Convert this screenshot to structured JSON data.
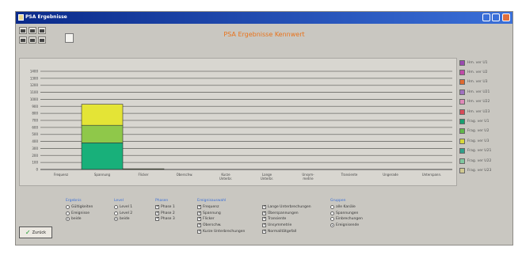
{
  "window": {
    "title": "PSA Ergebnisse"
  },
  "header": {
    "title": "PSA Ergebnisse Kennwert"
  },
  "colors": {
    "accent": "#e8731c",
    "link_blue": "#3a6fd8",
    "titlebar": "#0a2a8a"
  },
  "toolbar": {
    "icons": [
      "grid-icon",
      "table-icon",
      "chart-icon",
      "print-icon",
      "info-icon",
      "save-icon",
      "document-icon"
    ]
  },
  "chart_data": {
    "type": "bar",
    "categories": [
      "Frequenz",
      "Spannung",
      "Flicker",
      "Oberschw.",
      "Kurze\nUnterbr.",
      "Lange\nUnterbr.",
      "Unsym-\nmetrie",
      "Transiente",
      "Ungerade",
      "Unterspann."
    ],
    "series": [
      {
        "name": "Band 1",
        "values": [
          0,
          380,
          0,
          0,
          0,
          0,
          0,
          0,
          0,
          0
        ],
        "color": "#18b07a"
      },
      {
        "name": "Band 2",
        "values": [
          0,
          250,
          10,
          0,
          0,
          0,
          0,
          0,
          0,
          0
        ],
        "color": "#8fc84a"
      },
      {
        "name": "Band 3",
        "values": [
          0,
          300,
          0,
          0,
          0,
          0,
          0,
          0,
          0,
          0
        ],
        "color": "#e4e436"
      }
    ],
    "yticks": [
      "1400",
      "1300",
      "1200",
      "1100",
      "1000",
      "900",
      "800",
      "700",
      "600",
      "500",
      "400",
      "300",
      "200",
      "100",
      "0"
    ],
    "ylim": [
      0,
      1400
    ],
    "ylabel": "",
    "grid": true
  },
  "legend": [
    {
      "label": "Hm. ver U1",
      "color": "#9a4ab0"
    },
    {
      "label": "Hm. ver U2",
      "color": "#c04aa8"
    },
    {
      "label": "Hm. ver U3",
      "color": "#e06a30"
    },
    {
      "label": "Hm. ver U21",
      "color": "#a070c0"
    },
    {
      "label": "Hm. ver U22",
      "color": "#e08ab8"
    },
    {
      "label": "Hm. ver U23",
      "color": "#d84a58"
    },
    {
      "label": "Frag. ver U1",
      "color": "#18a070"
    },
    {
      "label": "Frag. ver U2",
      "color": "#60b84a"
    },
    {
      "label": "Frag. ver U3",
      "color": "#d8d83a"
    },
    {
      "label": "Frag. ver U21",
      "color": "#30a08a"
    },
    {
      "label": "Frag. ver U22",
      "color": "#80c8a0"
    },
    {
      "label": "Frag. ver U23",
      "color": "#d0c890"
    }
  ],
  "controls": {
    "ergebnis": {
      "title": "Ergebnis",
      "options": [
        {
          "label": "Gültigkeiten",
          "on": false
        },
        {
          "label": "Ereignisse",
          "on": false
        },
        {
          "label": "beide",
          "on": true
        }
      ]
    },
    "level": {
      "title": "Level",
      "options": [
        {
          "label": "Level 1",
          "on": false
        },
        {
          "label": "Level 2",
          "on": false
        },
        {
          "label": "beide",
          "on": true
        }
      ]
    },
    "phasen": {
      "title": "Phasen",
      "options": [
        {
          "label": "Phase 1",
          "on": true
        },
        {
          "label": "Phase 2",
          "on": true
        },
        {
          "label": "Phase 3",
          "on": true
        }
      ]
    },
    "merkmale_a": {
      "title": "Ereignisauswahl",
      "options": [
        {
          "label": "Frequenz",
          "on": true
        },
        {
          "label": "Spannung",
          "on": true
        },
        {
          "label": "Flicker",
          "on": true
        },
        {
          "label": "Oberschw.",
          "on": true
        },
        {
          "label": "Kurze Unterbrechungen",
          "on": true
        }
      ]
    },
    "merkmale_b": {
      "title": "",
      "options": [
        {
          "label": "Lange Unterbrechungen",
          "on": true
        },
        {
          "label": "Überspannungen",
          "on": true
        },
        {
          "label": "Transiente",
          "on": true
        },
        {
          "label": "Unsymmetrie",
          "on": true
        },
        {
          "label": "Normalitätgefall",
          "on": true
        }
      ]
    },
    "gruppen": {
      "title": "Gruppen",
      "options": [
        {
          "label": "alle Kanäle",
          "on": false
        },
        {
          "label": "Spannungen",
          "on": false
        },
        {
          "label": "Einbrechungen",
          "on": false
        },
        {
          "label": "Ereignisende",
          "on": true
        }
      ]
    }
  },
  "buttons": {
    "back_label": "Zurück"
  }
}
